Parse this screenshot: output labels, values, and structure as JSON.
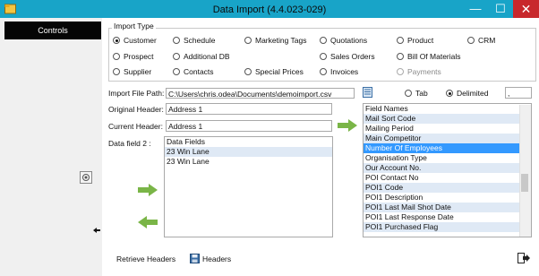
{
  "window": {
    "title": "Data Import (4.4.023-029)",
    "minimize_glyph": "—",
    "maximize_glyph": "☐",
    "close_glyph": "✕"
  },
  "sidebar": {
    "controls_label": "Controls"
  },
  "import_type": {
    "title": "Import Type",
    "options": [
      {
        "label": "Customer",
        "selected": true,
        "enabled": true
      },
      {
        "label": "Schedule",
        "selected": false,
        "enabled": true
      },
      {
        "label": "Marketing Tags",
        "selected": false,
        "enabled": true
      },
      {
        "label": "Quotations",
        "selected": false,
        "enabled": true
      },
      {
        "label": "Product",
        "selected": false,
        "enabled": true
      },
      {
        "label": "CRM",
        "selected": false,
        "enabled": true
      },
      {
        "label": "Prospect",
        "selected": false,
        "enabled": true
      },
      {
        "label": "Additional DB",
        "selected": false,
        "enabled": true
      },
      {
        "label": "Sales Orders",
        "selected": false,
        "enabled": true
      },
      {
        "label": "Bill Of Materials",
        "selected": false,
        "enabled": true
      },
      {
        "label": "Supplier",
        "selected": false,
        "enabled": true
      },
      {
        "label": "Contacts",
        "selected": false,
        "enabled": true
      },
      {
        "label": "Special Prices",
        "selected": false,
        "enabled": true
      },
      {
        "label": "Invoices",
        "selected": false,
        "enabled": true
      },
      {
        "label": "Payments",
        "selected": false,
        "enabled": false
      }
    ]
  },
  "file": {
    "path_label": "Import File Path:",
    "path_value": "C:\\Users\\chris.odea\\Documents\\demoimport.csv",
    "tab_label": "Tab",
    "delimited_label": "Delimited",
    "delimited_selected": true,
    "delimiter_value": ","
  },
  "headers": {
    "original_label": "Original Header:",
    "original_value": "Address 1",
    "current_label": "Current Header:",
    "current_value": "Address 1"
  },
  "data_field": {
    "label": "Data field 2 :",
    "items": [
      "Data Fields",
      "23 Win Lane",
      "23 Win Lane"
    ]
  },
  "field_names": {
    "items": [
      "Field Names",
      "Mail Sort Code",
      "Mailing Period",
      "Main Competitor",
      "Number Of Employees",
      "Organisation Type",
      "Our Account No.",
      "POI Contact No",
      "POI1 Code",
      "POI1 Description",
      "POI1 Last Mail Shot Date",
      "POI1 Last Response Date",
      "POI1 Purchased Flag"
    ],
    "selected_index": 4
  },
  "footer": {
    "retrieve_headers_label": "Retrieve Headers",
    "headers_label": "Headers"
  },
  "colors": {
    "titlebar": "#18a4c8",
    "selection": "#3399ff",
    "arrow_green": "#7ab547",
    "close_button": "#c8282c"
  }
}
